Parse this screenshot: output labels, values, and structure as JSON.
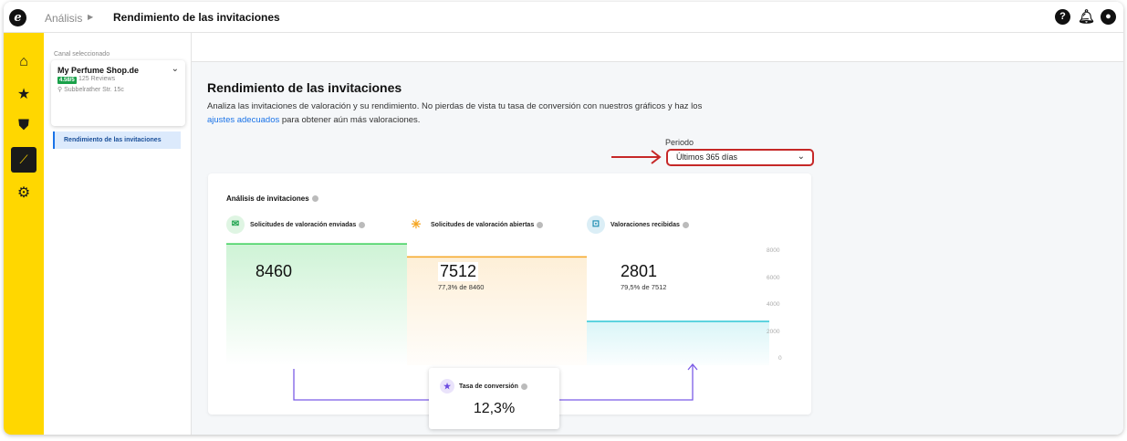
{
  "topbar": {
    "breadcrumb": "Análisis",
    "title": "Rendimiento de las invitaciones"
  },
  "sidebar": {
    "canal_label": "Canal seleccionado",
    "shop_name": "My Perfume Shop.de",
    "rating": "4.58/5",
    "reviews": "125 Reviews",
    "address": "Subbelrather Str. 15c",
    "nav_item": "Rendimiento de las invitaciones"
  },
  "main": {
    "page_title": "Rendimiento de las invitaciones",
    "desc_part1": "Analiza las invitaciones de valoración y su rendimiento. No pierdas de vista tu tasa de conversión con nuestros gráficos y haz los",
    "desc_link": "ajustes adecuados",
    "desc_part2": "para obtener aún más valoraciones.",
    "periodo_label": "Periodo",
    "periodo_value": "Últimos 365 días"
  },
  "card": {
    "title": "Análisis de invitaciones",
    "metrics": [
      {
        "label": "Solicitudes de valoración enviadas",
        "value": "8460",
        "sub": ""
      },
      {
        "label": "Solicitudes de valoración abiertas",
        "value": "7512",
        "sub": "77,3% de 8460"
      },
      {
        "label": "Valoraciones recibidas",
        "value": "2801",
        "sub": "79,5% de 7512"
      }
    ],
    "conversion_label": "Tasa de conversión",
    "conversion_value": "12,3%"
  },
  "chart_data": {
    "type": "area",
    "categories": [
      "Solicitudes de valoración enviadas",
      "Solicitudes de valoración abiertas",
      "Valoraciones recibidas"
    ],
    "values": [
      8460,
      7512,
      2801
    ],
    "ylim": [
      0,
      8000
    ],
    "yticks": [
      "8000",
      "6000",
      "4000",
      "2000",
      "0"
    ],
    "colors": [
      "#3ccf5a",
      "#f5a623",
      "#2fc7d6"
    ]
  }
}
